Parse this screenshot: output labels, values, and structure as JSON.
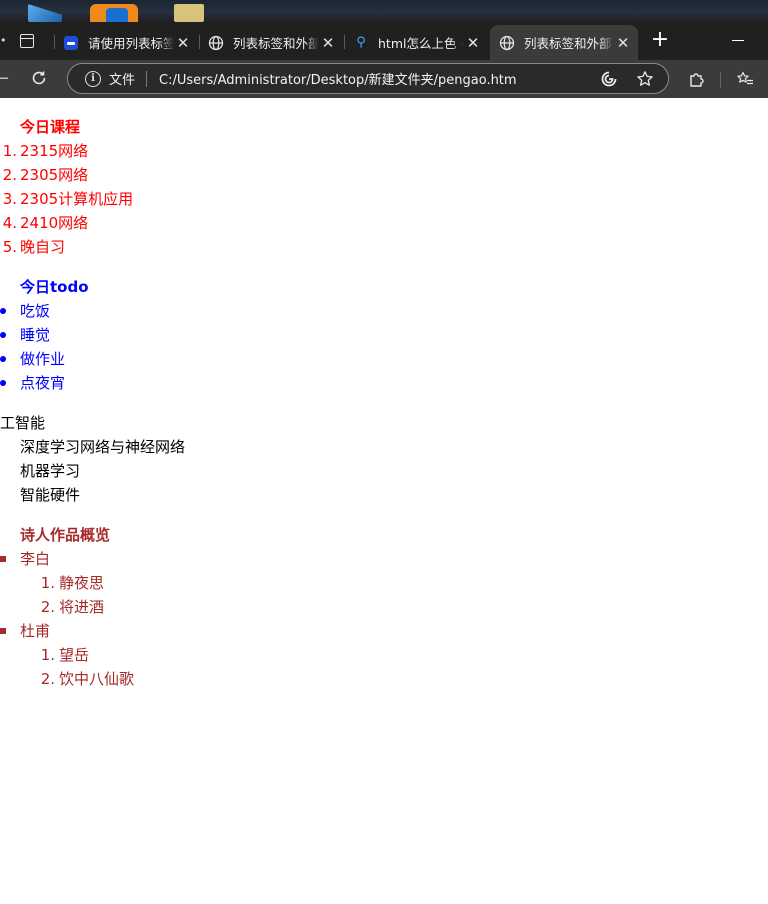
{
  "browser": {
    "tabs": [
      {
        "title": "请使用列表标签",
        "icon": "blue-page-icon",
        "active": false
      },
      {
        "title": "列表标签和外部",
        "icon": "globe-icon",
        "active": false
      },
      {
        "title": "html怎么上色 -",
        "icon": "search-icon",
        "active": false
      },
      {
        "title": "列表标签和外部",
        "icon": "globe-icon",
        "active": true
      }
    ],
    "address": {
      "scheme_label": "文件",
      "url": "C:/Users/Administrator/Desktop/新建文件夹/pengao.htm"
    }
  },
  "page": {
    "courses": {
      "caption": "今日课程",
      "color": "#ff0000",
      "items": [
        {
          "marker": "1.",
          "text": "2315网络"
        },
        {
          "marker": "2.",
          "text": "2305网络"
        },
        {
          "marker": "3.",
          "text": "2305计算机应用"
        },
        {
          "marker": "4.",
          "text": "2410网络"
        },
        {
          "marker": "5.",
          "text": "晚自习"
        }
      ]
    },
    "todo": {
      "caption": "今日todo",
      "color": "#0000ff",
      "items": [
        "吃饭",
        "睡觉",
        "做作业",
        "点夜宵"
      ]
    },
    "ai": {
      "term": "工智能",
      "color": "#000000",
      "descriptions": [
        "深度学习网络与神经网络",
        "机器学习",
        "智能硬件"
      ]
    },
    "poets": {
      "caption": "诗人作品概览",
      "color": "#a52a2a",
      "poets": [
        {
          "name": "李白",
          "works": [
            {
              "marker": "1.",
              "text": "静夜思"
            },
            {
              "marker": "2.",
              "text": "将进酒"
            }
          ]
        },
        {
          "name": "杜甫",
          "works": [
            {
              "marker": "1.",
              "text": "望岳"
            },
            {
              "marker": "2.",
              "text": "饮中八仙歌"
            }
          ]
        }
      ]
    }
  }
}
